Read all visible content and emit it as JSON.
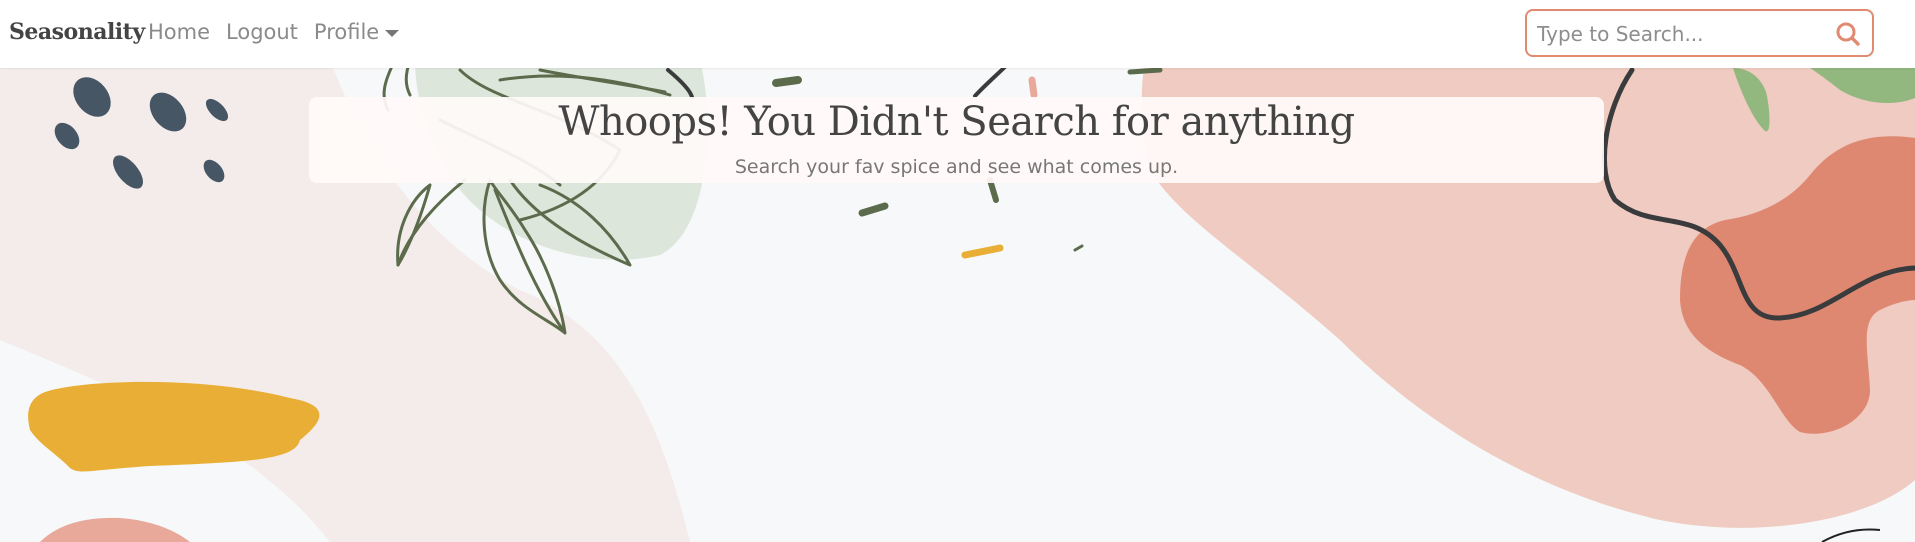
{
  "nav": {
    "brand": "Seasonality",
    "links": [
      {
        "label": "Home"
      },
      {
        "label": "Logout"
      },
      {
        "label": "Profile"
      }
    ]
  },
  "search": {
    "placeholder": "Type to Search...",
    "value": "",
    "icon": "search-icon"
  },
  "hero": {
    "title": "Whoops! You Didn't Search for anything",
    "subtitle": "Search your fav spice and see what comes up."
  },
  "colors": {
    "accent": "#e08a72",
    "text_dark": "#444444",
    "text_muted": "#777777",
    "mustard": "#e8ae35",
    "blush": "#efcbc1",
    "sage": "#dce6db",
    "leaf": "#5b6b4b",
    "navy_dot": "#465665"
  }
}
